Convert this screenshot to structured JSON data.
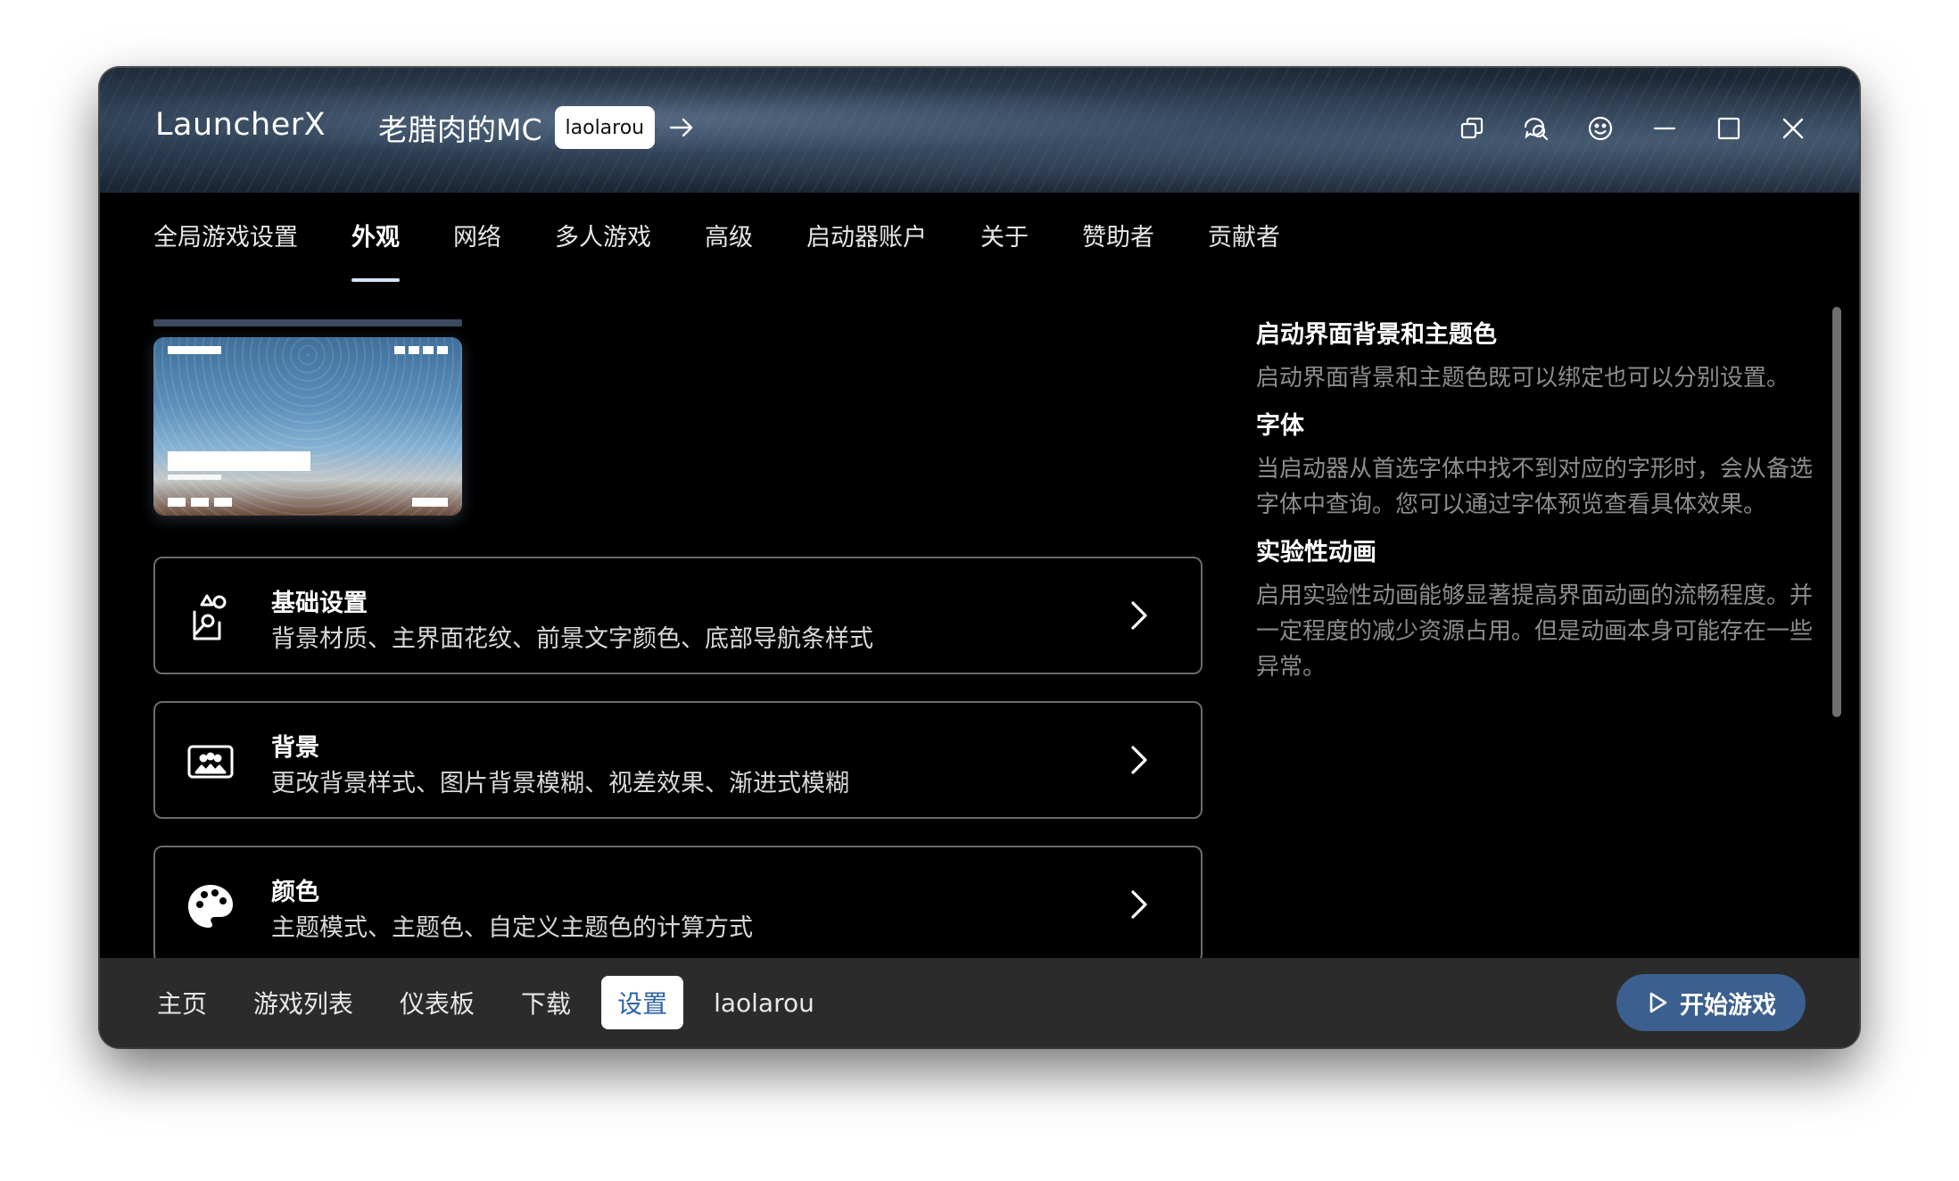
{
  "window": {
    "app_title": "LauncherX",
    "instance_name": "老腊肉的MC",
    "account_chip": "laolarou"
  },
  "tabs": [
    {
      "label": "全局游戏设置",
      "active": false
    },
    {
      "label": "外观",
      "active": true
    },
    {
      "label": "网络",
      "active": false
    },
    {
      "label": "多人游戏",
      "active": false
    },
    {
      "label": "高级",
      "active": false
    },
    {
      "label": "启动器账户",
      "active": false
    },
    {
      "label": "关于",
      "active": false
    },
    {
      "label": "赞助者",
      "active": false
    },
    {
      "label": "贡献者",
      "active": false
    }
  ],
  "cards": [
    {
      "title": "基础设置",
      "subtitle": "背景材质、主界面花纹、前景文字颜色、底部导航条样式",
      "icon": "brush-settings-icon"
    },
    {
      "title": "背景",
      "subtitle": "更改背景样式、图片背景模糊、视差效果、渐进式模糊",
      "icon": "image-background-icon"
    },
    {
      "title": "颜色",
      "subtitle": "主题模式、主题色、自定义主题色的计算方式",
      "icon": "palette-icon"
    }
  ],
  "side": [
    {
      "title": "启动界面背景和主题色",
      "body": "启动界面背景和主题色既可以绑定也可以分别设置。"
    },
    {
      "title": "字体",
      "body": "当启动器从首选字体中找不到对应的字形时，会从备选字体中查询。您可以通过字体预览查看具体效果。"
    },
    {
      "title": "实验性动画",
      "body": "启用实验性动画能够显著提高界面动画的流畅程度。并一定程度的减少资源占用。但是动画本身可能存在一些异常。"
    }
  ],
  "bottom_nav": [
    {
      "label": "主页",
      "active": false
    },
    {
      "label": "游戏列表",
      "active": false
    },
    {
      "label": "仪表板",
      "active": false
    },
    {
      "label": "下载",
      "active": false
    },
    {
      "label": "设置",
      "active": true
    },
    {
      "label": "laolarou",
      "active": false
    }
  ],
  "play_button": "开始游戏",
  "colors": {
    "accent": "#3b5f8e",
    "nav_active_text": "#2f63a8",
    "card_border": "#6b6b6b",
    "muted_text": "#8c8c8c"
  }
}
